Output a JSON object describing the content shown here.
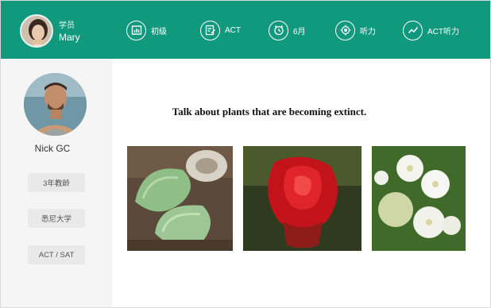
{
  "header": {
    "student": {
      "role": "学员",
      "name": "Mary",
      "avatar_icon": "student-avatar-photo"
    },
    "tags": [
      {
        "label": "初级",
        "icon": "bar-chart-icon"
      },
      {
        "label": "ACT",
        "icon": "edit-note-icon"
      },
      {
        "label": "6月",
        "icon": "alarm-clock-icon"
      },
      {
        "label": "听力",
        "icon": "target-icon"
      },
      {
        "label": "ACT听力",
        "icon": "trend-line-icon"
      }
    ],
    "color": "#11997e"
  },
  "sidebar": {
    "teacher_name": "Nick GC",
    "avatar_icon": "teacher-avatar-photo",
    "badges": [
      "3年教龄",
      "悉尼大学",
      "ACT / SAT"
    ]
  },
  "main": {
    "question": "Talk about plants that are becoming extinct.",
    "images": [
      {
        "name": "green-succulent-plant-image"
      },
      {
        "name": "red-flower-image"
      },
      {
        "name": "white-blossom-image"
      }
    ]
  }
}
